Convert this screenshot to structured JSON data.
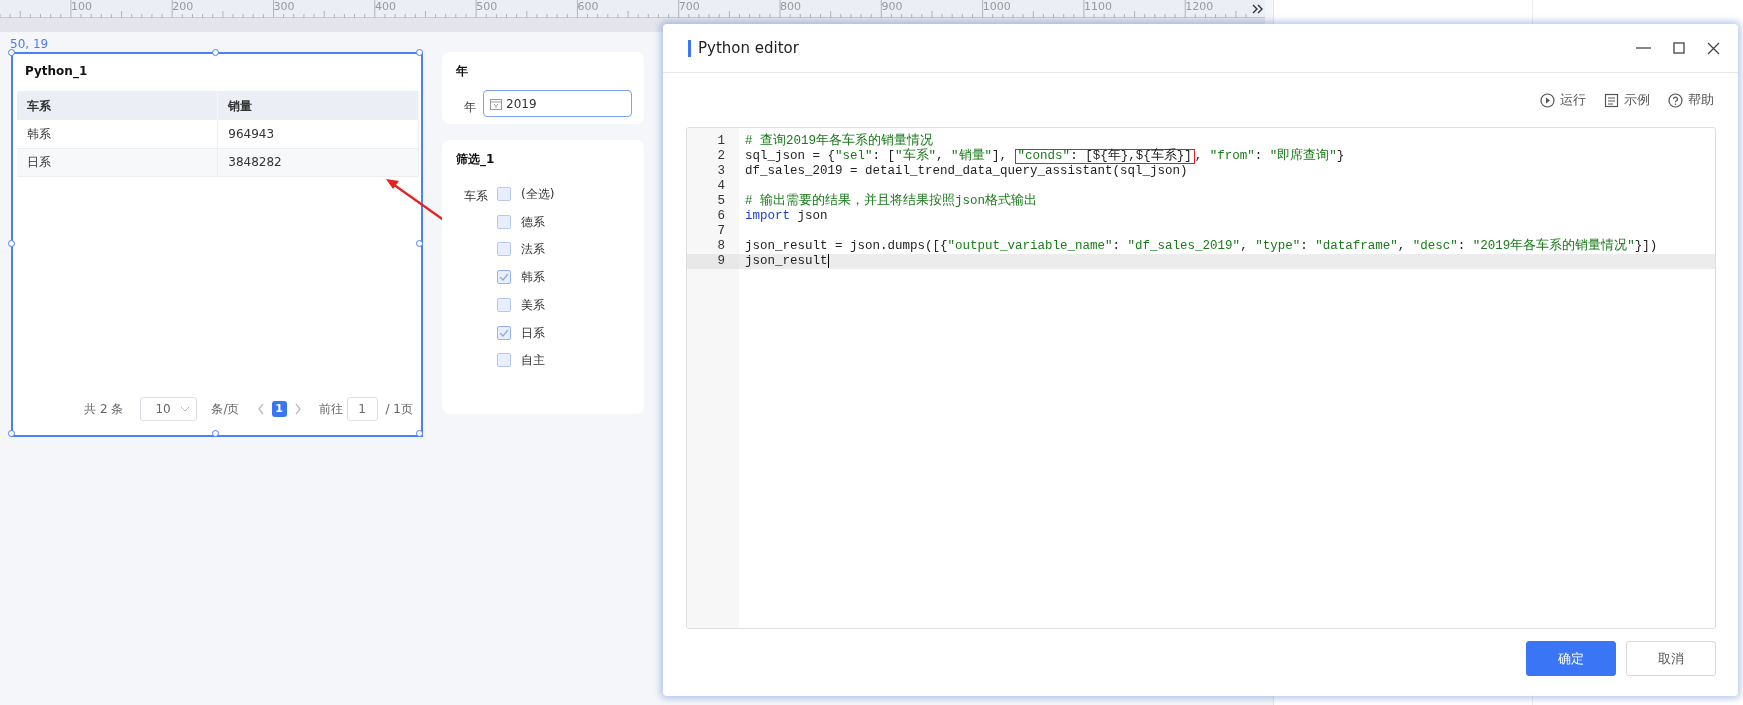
{
  "ruler": {
    "labels": [
      "100",
      "200",
      "300",
      "400",
      "500",
      "600",
      "700",
      "800",
      "900",
      "1000",
      "1100",
      "1200"
    ]
  },
  "canvas": {
    "position_label": "50, 19",
    "table_widget": {
      "title": "Python_1",
      "selected": true,
      "columns": [
        "车系",
        "销量"
      ],
      "rows": [
        [
          "韩系",
          "964943"
        ],
        [
          "日系",
          "3848282"
        ]
      ],
      "pagination": {
        "total": "共 2 条",
        "page_size": "10",
        "page_size_unit": "条/页",
        "pages": [
          {
            "label": "1",
            "selected": true
          }
        ],
        "goto_label": "前往",
        "goto_value": "1",
        "page_count": "/ 1页"
      }
    },
    "year_filter": {
      "title": "年",
      "label": "年",
      "value": "2019"
    },
    "checkbox_filter": {
      "title": "筛选_1",
      "label": "车系",
      "options": [
        {
          "label": "(全选)",
          "checked": false
        },
        {
          "label": "德系",
          "checked": false
        },
        {
          "label": "法系",
          "checked": false
        },
        {
          "label": "韩系",
          "checked": true
        },
        {
          "label": "美系",
          "checked": false
        },
        {
          "label": "日系",
          "checked": true
        },
        {
          "label": "自主",
          "checked": false
        }
      ]
    }
  },
  "editor": {
    "title": "Python editor",
    "toolbar": [
      {
        "label": "运行",
        "kind": "run"
      },
      {
        "label": "示例",
        "kind": "example"
      },
      {
        "label": "帮助",
        "kind": "help"
      }
    ],
    "code_lines": [
      {
        "number": "1",
        "current": false,
        "tokens": [
          {
            "kind": "comment",
            "text": "# 查询2019年各车系的销量情况"
          }
        ]
      },
      {
        "number": "2",
        "current": false,
        "tokens": [
          {
            "kind": "plain",
            "text": "sql_json = {"
          },
          {
            "kind": "string",
            "text": "\"sel\""
          },
          {
            "kind": "plain",
            "text": ": ["
          },
          {
            "kind": "string",
            "text": "\"车系\""
          },
          {
            "kind": "plain",
            "text": ", "
          },
          {
            "kind": "string",
            "text": "\"销量\""
          },
          {
            "kind": "plain",
            "text": "], "
          },
          {
            "kind": "string",
            "text": "\"conds\"",
            "boxed": true
          },
          {
            "kind": "plain",
            "text": ": [${年},${车系}]",
            "boxed": true
          },
          {
            "kind": "plain",
            "text": ", "
          },
          {
            "kind": "string",
            "text": "\"from\""
          },
          {
            "kind": "plain",
            "text": ": "
          },
          {
            "kind": "string",
            "text": "\"即席查询\""
          },
          {
            "kind": "plain",
            "text": "}"
          }
        ]
      },
      {
        "number": "3",
        "current": false,
        "tokens": [
          {
            "kind": "plain",
            "text": "df_sales_2019 = detail_trend_data_query_assistant(sql_json)"
          }
        ]
      },
      {
        "number": "4",
        "current": false
      },
      {
        "number": "5",
        "current": false,
        "tokens": [
          {
            "kind": "comment",
            "text": "# 输出需要的结果，并且将结果按照json格式输出"
          }
        ]
      },
      {
        "number": "6",
        "current": false,
        "tokens": [
          {
            "kind": "keyword",
            "text": "import"
          },
          {
            "kind": "plain",
            "text": " json"
          }
        ]
      },
      {
        "number": "7",
        "current": false
      },
      {
        "number": "8",
        "current": false,
        "tokens": [
          {
            "kind": "plain",
            "text": "json_result = json.dumps([{"
          },
          {
            "kind": "string",
            "text": "\"output_variable_name\""
          },
          {
            "kind": "plain",
            "text": ": "
          },
          {
            "kind": "string",
            "text": "\"df_sales_2019\""
          },
          {
            "kind": "plain",
            "text": ", "
          },
          {
            "kind": "string",
            "text": "\"type\""
          },
          {
            "kind": "plain",
            "text": ": "
          },
          {
            "kind": "string",
            "text": "\"dataframe\""
          },
          {
            "kind": "plain",
            "text": ", "
          },
          {
            "kind": "string",
            "text": "\"desc\""
          },
          {
            "kind": "plain",
            "text": ": "
          },
          {
            "kind": "string",
            "text": "\"2019年各车系的销量情况\""
          },
          {
            "kind": "plain",
            "text": "}])"
          }
        ]
      },
      {
        "number": "9",
        "current": true,
        "tokens": [
          {
            "kind": "plain",
            "text": "json_result"
          }
        ]
      }
    ],
    "buttons": [
      {
        "label": "确定",
        "kind": "primary"
      },
      {
        "label": "取消",
        "kind": "secondary"
      }
    ]
  }
}
